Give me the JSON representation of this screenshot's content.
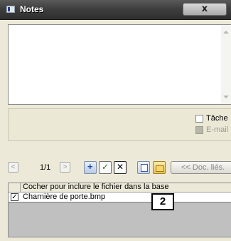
{
  "window": {
    "title": "Notes",
    "close_glyph": "x"
  },
  "notes": {
    "value": ""
  },
  "options": {
    "task_label": "Tâche",
    "email_label": "E-mail"
  },
  "toolbar": {
    "prev_glyph": "<",
    "page_counter": "1/1",
    "next_glyph": ">",
    "doc_lies_label": "<< Doc. liés."
  },
  "files": {
    "header": "Cocher pour inclure le fichier dans la base",
    "rows": [
      {
        "name": "Charnière de porte.bmp",
        "checked": true,
        "check_glyph": "✓"
      }
    ]
  },
  "callout": {
    "label": "2"
  },
  "colors": {
    "titlebar": "#3f3f3f",
    "window_bg": "#ece9d8",
    "list_bg": "#c0c0c0"
  },
  "icons": [
    "app-icon",
    "close-icon",
    "add-icon",
    "validate-icon",
    "delete-icon",
    "copy-icon",
    "folder-icon"
  ]
}
